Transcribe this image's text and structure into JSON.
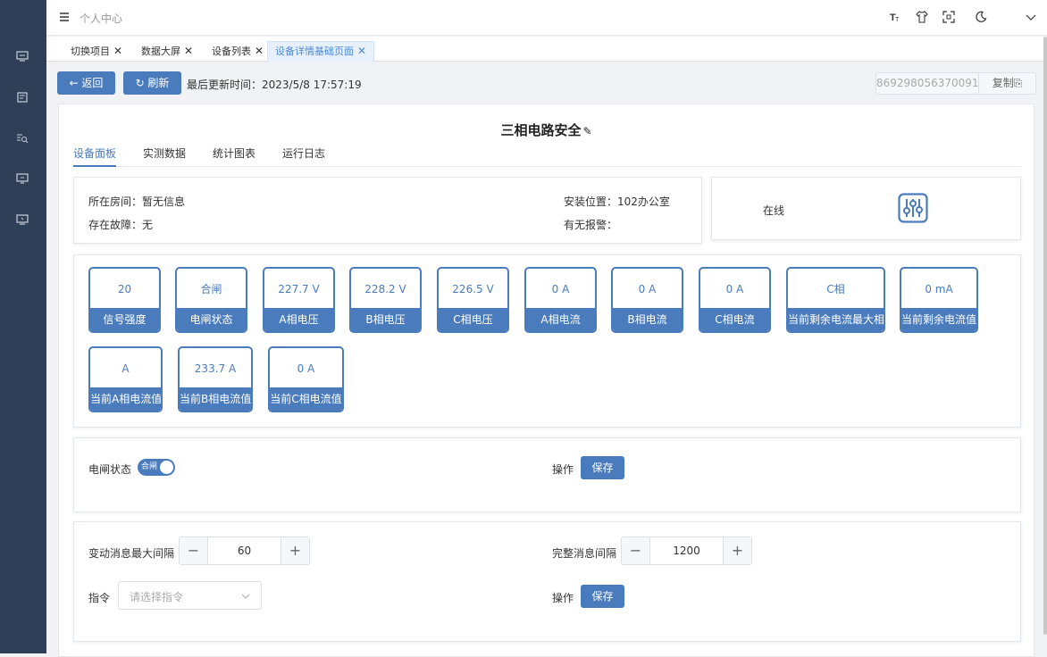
{
  "sidebar": {
    "icons": [
      "monitor-icon",
      "dashboard-icon",
      "list-search-icon",
      "chat-monitor-icon",
      "screen-icon"
    ]
  },
  "topbar": {
    "title": "个人中心",
    "icons": [
      "font-size-icon",
      "theme-shirt-icon",
      "fullscreen-icon",
      "dark-mode-icon",
      "chevron-down-icon"
    ]
  },
  "tabs": [
    {
      "label": "切换项目",
      "close": "✕"
    },
    {
      "label": "数据大屏",
      "close": "✕"
    },
    {
      "label": "设备列表",
      "close": "✕"
    },
    {
      "label": "设备详情基础页面",
      "close": "✕",
      "active": true
    }
  ],
  "toolbar": {
    "back_label": "← 返回",
    "refresh_label": "↻ 刷新",
    "update_label": "最后更新时间：2023/5/8 17:57:19",
    "device_id": "869298056370091",
    "copy_label": "复制⎘"
  },
  "device": {
    "title": "三相电路安全",
    "edit_glyph": "✎",
    "tabs": [
      "设备面板",
      "实测数据",
      "统计图表",
      "运行日志"
    ],
    "room": "所在房间：暂无信息",
    "fault": "存在故障：无",
    "location": "安装位置：102办公室",
    "alarm": "有无报警：",
    "status": "在线"
  },
  "metrics": [
    {
      "value": "20",
      "label": "信号强度"
    },
    {
      "value": "合闸",
      "label": "电闸状态"
    },
    {
      "value": "227.7 V",
      "label": "A相电压"
    },
    {
      "value": "228.2 V",
      "label": "B相电压"
    },
    {
      "value": "226.5 V",
      "label": "C相电压"
    },
    {
      "value": "0 A",
      "label": "A相电流"
    },
    {
      "value": "0 A",
      "label": "B相电流"
    },
    {
      "value": "0 A",
      "label": "C相电流"
    },
    {
      "value": "C相",
      "label": "当前剩余电流最大相"
    },
    {
      "value": "0 mA",
      "label": "当前剩余电流值"
    },
    {
      "value": "A",
      "label": "当前A相电流值"
    },
    {
      "value": "233.7 A",
      "label": "当前B相电流值"
    },
    {
      "value": "0 A",
      "label": "当前C相电流值"
    }
  ],
  "switch_panel": {
    "label": "电闸状态",
    "toggle_text": "合闸",
    "toggle_on": true,
    "op_label": "操作",
    "save_label": "保存"
  },
  "config_panel": {
    "interval_label": "变动消息最大间隔",
    "interval_value": "60",
    "full_label": "完整消息间隔",
    "full_value": "1200",
    "minus": "−",
    "plus": "+",
    "cmd_label": "指令",
    "cmd_placeholder": "请选择指令",
    "op_label": "操作",
    "save_label": "保存"
  },
  "colors": {
    "primary": "#4a7bbd",
    "sidebar": "#2f3f57"
  }
}
